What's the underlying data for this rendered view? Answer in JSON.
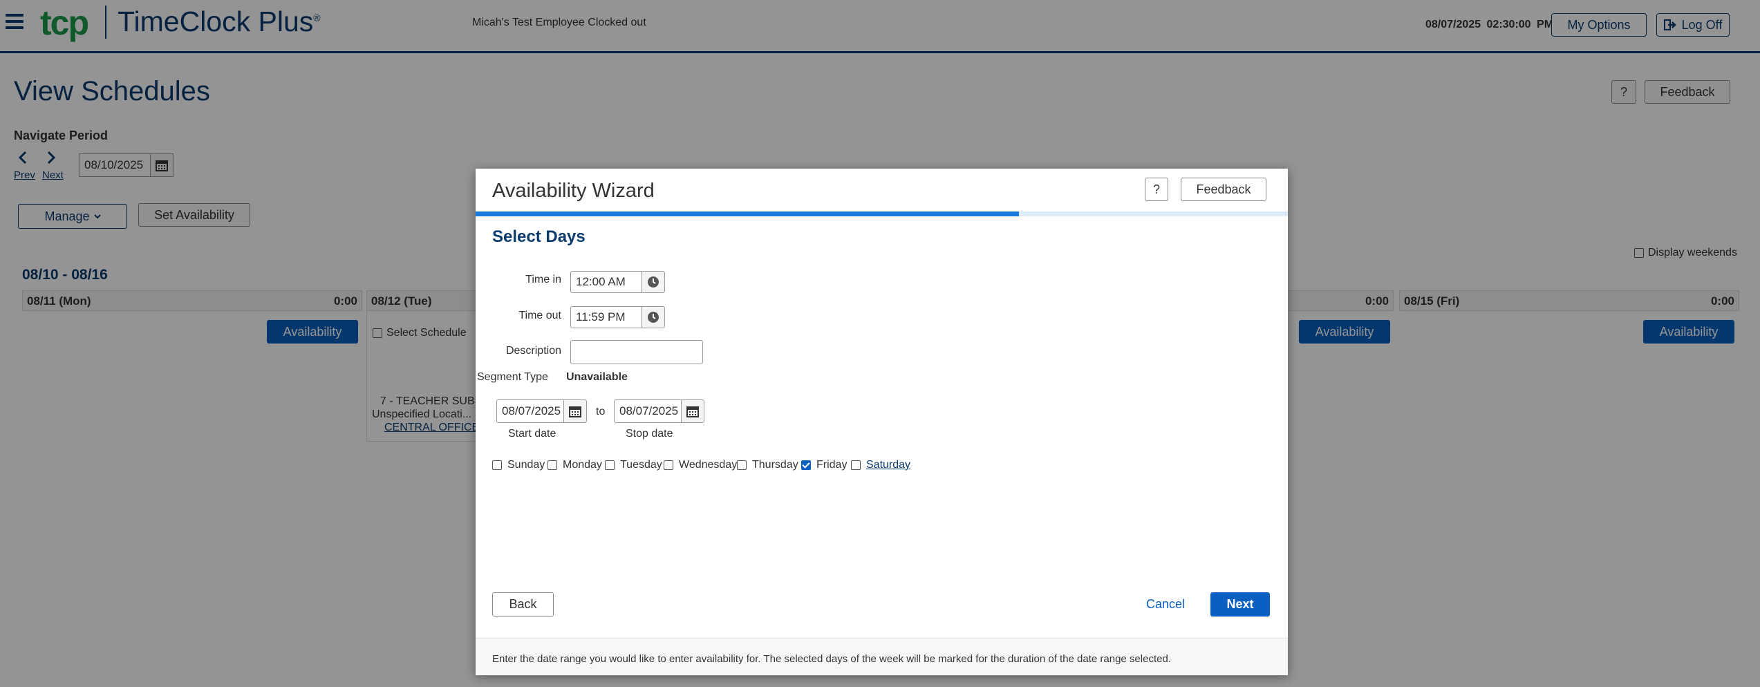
{
  "header": {
    "logo_mark": "tcp",
    "logo_text": "TimeClock Plus",
    "status": "Micah's Test Employee Clocked out",
    "datetime": "08/07/2025  02:30:00 PM",
    "my_options": "My Options",
    "log_off": "Log Off"
  },
  "page": {
    "title": "View Schedules",
    "help": "?",
    "feedback": "Feedback",
    "navigate_period": "Navigate Period",
    "prev": "Prev",
    "next": "Next",
    "period_date": "08/10/2025",
    "manage": "Manage",
    "set_availability": "Set Availability",
    "display_weekends": "Display weekends",
    "week_range": "08/10 - 08/16",
    "days": [
      {
        "label": "08/11 (Mon)",
        "hours": "0:00",
        "button": "Availability"
      },
      {
        "label": "08/12 (Tue)",
        "hours": "",
        "select_schedule": "Select Schedule",
        "shift_title": "7 - TEACHER SUB",
        "shift_location": "Unspecified Locati...",
        "shift_link": "CENTRAL OFFICE"
      },
      {
        "label": "",
        "hours": "0:00",
        "button": "Availability"
      },
      {
        "label": "08/15 (Fri)",
        "hours": "0:00",
        "button": "Availability"
      }
    ]
  },
  "modal": {
    "title": "Availability Wizard",
    "help": "?",
    "feedback": "Feedback",
    "progress": 0.67,
    "section_title": "Select Days",
    "time_in_label": "Time in",
    "time_in": "12:00 AM",
    "time_out_label": "Time out",
    "time_out": "11:59 PM",
    "description_label": "Description",
    "description": "",
    "segment_type_label": "Segment Type",
    "segment_type": "Unavailable",
    "start_date": "08/07/2025",
    "to": "to",
    "stop_date": "08/07/2025",
    "start_date_label": "Start date",
    "stop_date_label": "Stop date",
    "days": [
      {
        "label": "Sunday",
        "checked": false
      },
      {
        "label": "Monday",
        "checked": false
      },
      {
        "label": "Tuesday",
        "checked": false
      },
      {
        "label": "Wednesday",
        "checked": false
      },
      {
        "label": "Thursday",
        "checked": false
      },
      {
        "label": "Friday",
        "checked": true
      },
      {
        "label": "Saturday",
        "checked": false
      }
    ],
    "back": "Back",
    "cancel": "Cancel",
    "next": "Next",
    "footer_text": "Enter the date range you would like to enter availability for. The selected days of the week will be marked for the duration of the date range selected."
  },
  "colors": {
    "brand_navy": "#0b3c6e",
    "brand_green": "#1a9a4a",
    "primary_blue": "#0a5fc0",
    "progress_blue": "#1a7ad9"
  }
}
